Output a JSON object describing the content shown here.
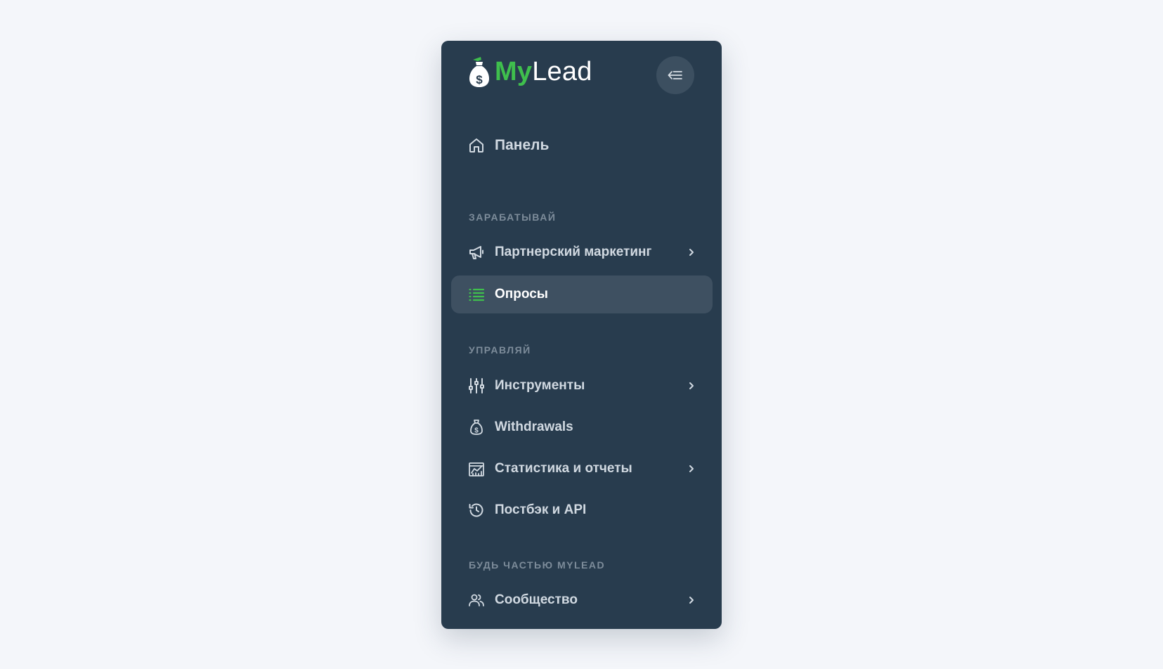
{
  "brand": {
    "name_part1": "My",
    "name_part2": "Lead",
    "accent_color": "#3fbf4d"
  },
  "collapse_button": {
    "icon": "collapse-menu-icon"
  },
  "nav": {
    "dashboard": {
      "label": "Панель",
      "icon": "home-icon"
    },
    "sections": [
      {
        "title": "ЗАРАБАТЫВАЙ",
        "items": [
          {
            "label": "Партнерский маркетинг",
            "icon": "megaphone-icon",
            "has_submenu": true
          },
          {
            "label": "Опросы",
            "icon": "list-icon",
            "active": true
          }
        ]
      },
      {
        "title": "УПРАВЛЯЙ",
        "items": [
          {
            "label": "Инструменты",
            "icon": "sliders-icon",
            "has_submenu": true
          },
          {
            "label": "Withdrawals",
            "icon": "money-bag-icon"
          },
          {
            "label": "Статистика и отчеты",
            "icon": "chart-icon",
            "has_submenu": true
          },
          {
            "label": "Постбэк и API",
            "icon": "history-icon"
          }
        ]
      },
      {
        "title": "БУДЬ ЧАСТЬЮ MYLEAD",
        "items": [
          {
            "label": "Сообщество",
            "icon": "users-icon",
            "has_submenu": true
          }
        ]
      }
    ]
  },
  "colors": {
    "sidebar_bg": "#283c4e",
    "active_item_bg": "#3e5061",
    "page_bg": "#f4f6fa"
  }
}
